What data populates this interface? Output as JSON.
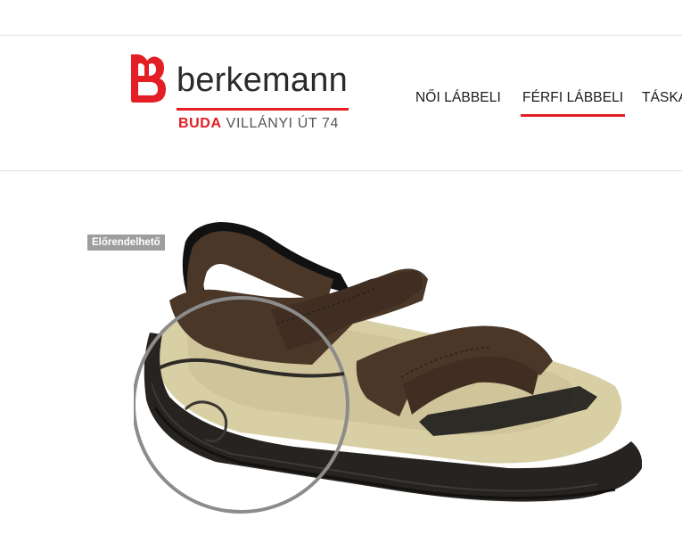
{
  "brand": {
    "name": "berkemann",
    "city": "BUDA",
    "street": "VILLÁNYI ÚT 74",
    "color": "#e31e24"
  },
  "nav": {
    "items": [
      {
        "label": "NŐI LÁBBELI",
        "active": false
      },
      {
        "label": "FÉRFI LÁBBELI",
        "active": true
      },
      {
        "label": "TÁSKA",
        "active": false
      }
    ]
  },
  "product": {
    "badge": "Előrendelhető",
    "image_icon": "sandal-image",
    "detail_icon": "sole-zoom-circle"
  }
}
